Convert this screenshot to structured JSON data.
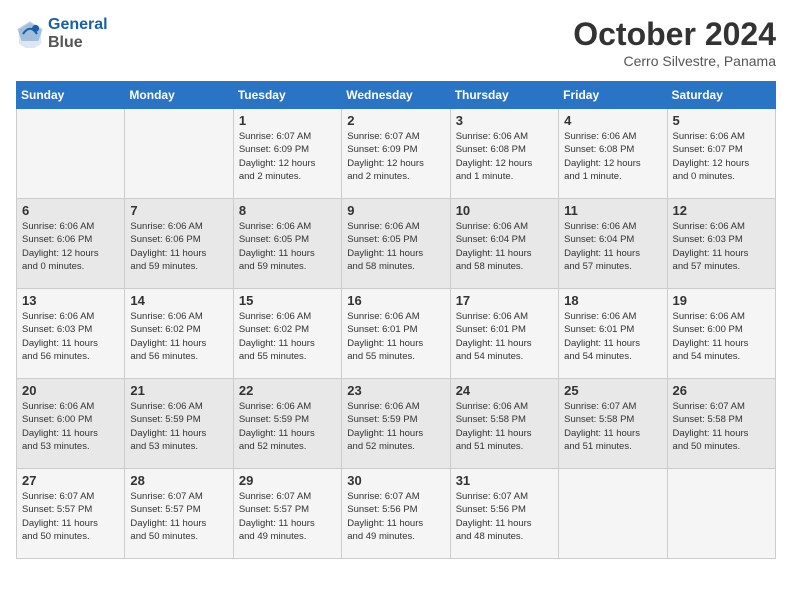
{
  "header": {
    "logo_line1": "General",
    "logo_line2": "Blue",
    "month": "October 2024",
    "location": "Cerro Silvestre, Panama"
  },
  "days_of_week": [
    "Sunday",
    "Monday",
    "Tuesday",
    "Wednesday",
    "Thursday",
    "Friday",
    "Saturday"
  ],
  "weeks": [
    [
      {
        "day": "",
        "info": ""
      },
      {
        "day": "",
        "info": ""
      },
      {
        "day": "1",
        "info": "Sunrise: 6:07 AM\nSunset: 6:09 PM\nDaylight: 12 hours\nand 2 minutes."
      },
      {
        "day": "2",
        "info": "Sunrise: 6:07 AM\nSunset: 6:09 PM\nDaylight: 12 hours\nand 2 minutes."
      },
      {
        "day": "3",
        "info": "Sunrise: 6:06 AM\nSunset: 6:08 PM\nDaylight: 12 hours\nand 1 minute."
      },
      {
        "day": "4",
        "info": "Sunrise: 6:06 AM\nSunset: 6:08 PM\nDaylight: 12 hours\nand 1 minute."
      },
      {
        "day": "5",
        "info": "Sunrise: 6:06 AM\nSunset: 6:07 PM\nDaylight: 12 hours\nand 0 minutes."
      }
    ],
    [
      {
        "day": "6",
        "info": "Sunrise: 6:06 AM\nSunset: 6:06 PM\nDaylight: 12 hours\nand 0 minutes."
      },
      {
        "day": "7",
        "info": "Sunrise: 6:06 AM\nSunset: 6:06 PM\nDaylight: 11 hours\nand 59 minutes."
      },
      {
        "day": "8",
        "info": "Sunrise: 6:06 AM\nSunset: 6:05 PM\nDaylight: 11 hours\nand 59 minutes."
      },
      {
        "day": "9",
        "info": "Sunrise: 6:06 AM\nSunset: 6:05 PM\nDaylight: 11 hours\nand 58 minutes."
      },
      {
        "day": "10",
        "info": "Sunrise: 6:06 AM\nSunset: 6:04 PM\nDaylight: 11 hours\nand 58 minutes."
      },
      {
        "day": "11",
        "info": "Sunrise: 6:06 AM\nSunset: 6:04 PM\nDaylight: 11 hours\nand 57 minutes."
      },
      {
        "day": "12",
        "info": "Sunrise: 6:06 AM\nSunset: 6:03 PM\nDaylight: 11 hours\nand 57 minutes."
      }
    ],
    [
      {
        "day": "13",
        "info": "Sunrise: 6:06 AM\nSunset: 6:03 PM\nDaylight: 11 hours\nand 56 minutes."
      },
      {
        "day": "14",
        "info": "Sunrise: 6:06 AM\nSunset: 6:02 PM\nDaylight: 11 hours\nand 56 minutes."
      },
      {
        "day": "15",
        "info": "Sunrise: 6:06 AM\nSunset: 6:02 PM\nDaylight: 11 hours\nand 55 minutes."
      },
      {
        "day": "16",
        "info": "Sunrise: 6:06 AM\nSunset: 6:01 PM\nDaylight: 11 hours\nand 55 minutes."
      },
      {
        "day": "17",
        "info": "Sunrise: 6:06 AM\nSunset: 6:01 PM\nDaylight: 11 hours\nand 54 minutes."
      },
      {
        "day": "18",
        "info": "Sunrise: 6:06 AM\nSunset: 6:01 PM\nDaylight: 11 hours\nand 54 minutes."
      },
      {
        "day": "19",
        "info": "Sunrise: 6:06 AM\nSunset: 6:00 PM\nDaylight: 11 hours\nand 54 minutes."
      }
    ],
    [
      {
        "day": "20",
        "info": "Sunrise: 6:06 AM\nSunset: 6:00 PM\nDaylight: 11 hours\nand 53 minutes."
      },
      {
        "day": "21",
        "info": "Sunrise: 6:06 AM\nSunset: 5:59 PM\nDaylight: 11 hours\nand 53 minutes."
      },
      {
        "day": "22",
        "info": "Sunrise: 6:06 AM\nSunset: 5:59 PM\nDaylight: 11 hours\nand 52 minutes."
      },
      {
        "day": "23",
        "info": "Sunrise: 6:06 AM\nSunset: 5:59 PM\nDaylight: 11 hours\nand 52 minutes."
      },
      {
        "day": "24",
        "info": "Sunrise: 6:06 AM\nSunset: 5:58 PM\nDaylight: 11 hours\nand 51 minutes."
      },
      {
        "day": "25",
        "info": "Sunrise: 6:07 AM\nSunset: 5:58 PM\nDaylight: 11 hours\nand 51 minutes."
      },
      {
        "day": "26",
        "info": "Sunrise: 6:07 AM\nSunset: 5:58 PM\nDaylight: 11 hours\nand 50 minutes."
      }
    ],
    [
      {
        "day": "27",
        "info": "Sunrise: 6:07 AM\nSunset: 5:57 PM\nDaylight: 11 hours\nand 50 minutes."
      },
      {
        "day": "28",
        "info": "Sunrise: 6:07 AM\nSunset: 5:57 PM\nDaylight: 11 hours\nand 50 minutes."
      },
      {
        "day": "29",
        "info": "Sunrise: 6:07 AM\nSunset: 5:57 PM\nDaylight: 11 hours\nand 49 minutes."
      },
      {
        "day": "30",
        "info": "Sunrise: 6:07 AM\nSunset: 5:56 PM\nDaylight: 11 hours\nand 49 minutes."
      },
      {
        "day": "31",
        "info": "Sunrise: 6:07 AM\nSunset: 5:56 PM\nDaylight: 11 hours\nand 48 minutes."
      },
      {
        "day": "",
        "info": ""
      },
      {
        "day": "",
        "info": ""
      }
    ]
  ]
}
